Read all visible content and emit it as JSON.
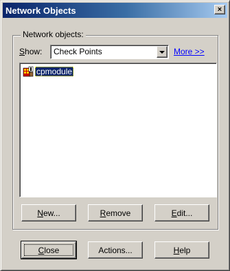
{
  "window": {
    "title": "Network Objects"
  },
  "titlebar": {
    "close_glyph": "×"
  },
  "group": {
    "legend": "Network objects:"
  },
  "filter": {
    "label_mnemonic": "S",
    "label_rest": "how:",
    "selected": "Check Points",
    "more_link": "More >>"
  },
  "list": {
    "items": [
      {
        "label": "cpmodule",
        "icon": "checkpoint-gateway-icon",
        "selected": true
      }
    ]
  },
  "group_buttons": {
    "new": {
      "mnemonic": "N",
      "rest": "ew..."
    },
    "remove": {
      "mnemonic": "R",
      "rest": "emove"
    },
    "edit": {
      "mnemonic": "E",
      "rest": "dit..."
    }
  },
  "dialog_buttons": {
    "close": {
      "mnemonic": "C",
      "rest": "lose"
    },
    "actions": {
      "label": "Actions..."
    },
    "help": {
      "mnemonic": "H",
      "rest": "elp"
    }
  },
  "colors": {
    "title_start": "#0a246a",
    "title_end": "#a6caf0",
    "face": "#d4d0c8",
    "selection": "#0a246a",
    "link": "#0000ff"
  }
}
